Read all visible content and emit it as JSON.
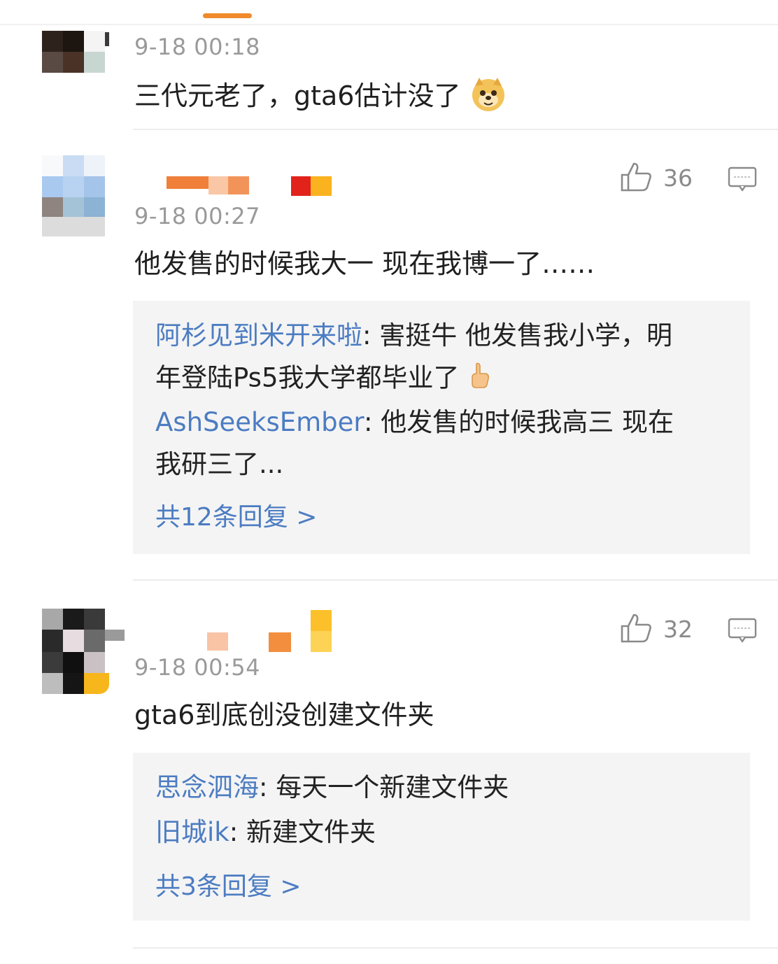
{
  "colors": {
    "accent_orange": "#f08a2c",
    "link_blue": "#4c7cc2",
    "timestamp_gray": "#9a9a9a",
    "reply_bg": "#f4f4f4"
  },
  "comments": [
    {
      "time": "9-18 00:18",
      "text": "三代元老了，gta6估计没了",
      "emoji": "doge-emoji-icon"
    },
    {
      "time": "9-18 00:27",
      "text": "他发售的时候我大一  现在我博一了……",
      "likes": "36",
      "replies": [
        {
          "name": "阿杉见到米开来啦",
          "sep": ": ",
          "text1": "害挺牛 他发售我小学，明",
          "text2": "年登陆Ps5我大学都毕业了",
          "emoji": "thumb-hand-icon"
        },
        {
          "name": "AshSeeksEmber",
          "sep": ": ",
          "text1": "他发售的时候我高三 现在",
          "text2": "我研三了..."
        }
      ],
      "more_label": "共12条回复 >"
    },
    {
      "time": "9-18 00:54",
      "text": "gta6到底创没创建文件夹",
      "likes": "32",
      "replies": [
        {
          "name": "思念泗海",
          "sep": ": ",
          "text1": "每天一个新建文件夹"
        },
        {
          "name": "旧城ik",
          "sep": ": ",
          "text1": "新建文件夹"
        }
      ],
      "more_label": "共3条回复 >"
    }
  ]
}
